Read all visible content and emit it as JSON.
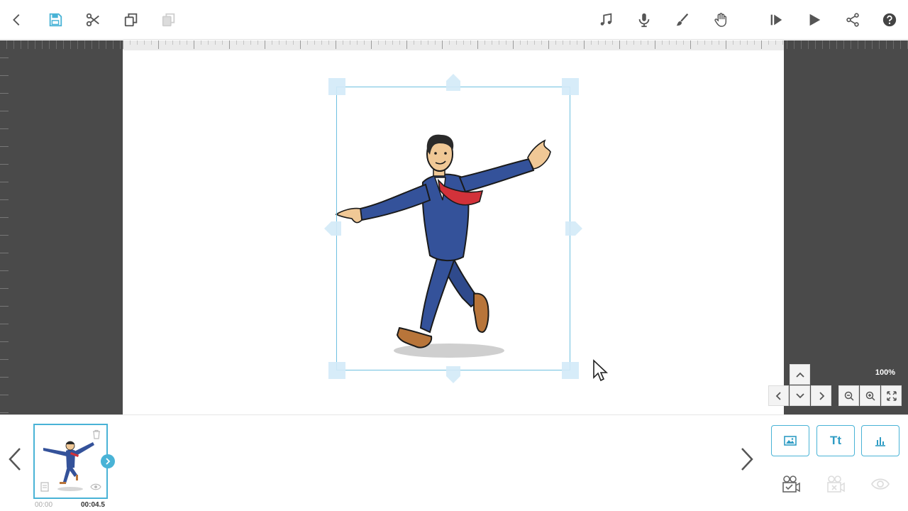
{
  "toolbar": {
    "left_icons": [
      "back-icon",
      "save-icon",
      "cut-icon",
      "copy-icon",
      "paste-icon"
    ],
    "right_icons": [
      "music-icon",
      "microphone-icon",
      "brush-icon",
      "hand-icon",
      "play-from-slide-icon",
      "play-icon",
      "share-icon",
      "help-icon"
    ],
    "accent": "#49b3d6"
  },
  "canvas": {
    "zoom": "100%",
    "background": "#ffffff",
    "selection_color": "#6fc0e0"
  },
  "controls": {
    "pan_icons": [
      "pan-up-icon",
      "pan-left-icon",
      "pan-down-icon",
      "pan-right-icon"
    ],
    "zoom_icons": [
      "zoom-out-icon",
      "zoom-in-icon",
      "fit-screen-icon"
    ]
  },
  "timeline": {
    "slides": [
      {
        "start": "00:00",
        "end": "00:04.5"
      }
    ]
  },
  "add_panel": {
    "image_icon": "image-icon",
    "text_label": "Tt",
    "chart_icon": "chart-icon"
  },
  "footer_icons": [
    "camera-check-icon",
    "camera-remove-icon",
    "preview-eye-icon"
  ]
}
